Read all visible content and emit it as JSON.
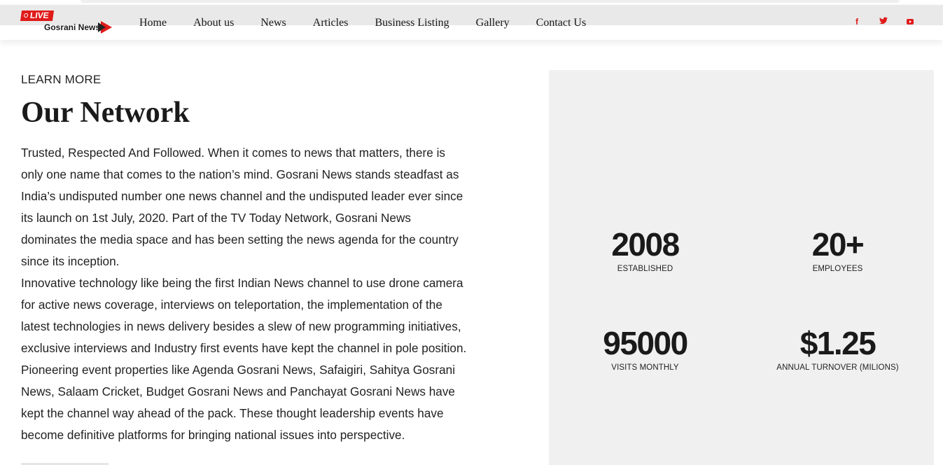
{
  "header": {
    "logo_badge": "LIVE",
    "logo_name": "Gosrani News",
    "nav": [
      "Home",
      "About us",
      "News",
      "Articles",
      "Business Listing",
      "Gallery",
      "Contact Us"
    ],
    "social": [
      "facebook-icon",
      "twitter-icon",
      "youtube-icon"
    ],
    "accent_color": "#e01b1b"
  },
  "main": {
    "eyebrow": "LEARN MORE",
    "title": "Our Network",
    "paragraph_1": "Trusted, Respected And Followed. When it comes to news that matters, there is only one name that comes to the nation’s mind. Gosrani News stands steadfast as India’s undisputed number one news channel and the undisputed leader ever since its launch on 1st July, 2020. Part of the TV Today Network, Gosrani News dominates the media space and has been setting the news agenda for the country since its inception.",
    "paragraph_2": "Innovative technology like being the first Indian News channel to use drone camera for active news coverage, interviews on teleportation, the implementation of the latest technologies in news delivery besides a slew of new programming initiatives, exclusive interviews and Industry first events have kept the channel in pole position. Pioneering event properties like Agenda Gosrani News, Safaigiri, Sahitya Gosrani News, Salaam Cricket, Budget Gosrani News and Panchayat Gosrani News have kept the channel way ahead of the pack. These thought leadership events have become definitive platforms for bringing national issues into perspective."
  },
  "stats": [
    {
      "value": "2008",
      "label": "ESTABLISHED"
    },
    {
      "value": "20+",
      "label": "EMPLOYEES"
    },
    {
      "value": "95000",
      "label": "VISITS MONTHLY"
    },
    {
      "value": "$1.25",
      "label": "ANNUAL TURNOVER (MILIONS)"
    }
  ]
}
